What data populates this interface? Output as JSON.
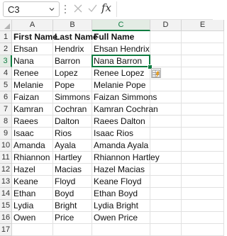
{
  "formula_bar": {
    "name_box": "C3",
    "fx_label": "fx",
    "formula_value": ""
  },
  "columns": [
    {
      "label": "A",
      "active": false
    },
    {
      "label": "B",
      "active": false
    },
    {
      "label": "C",
      "active": true
    },
    {
      "label": "D",
      "active": false
    },
    {
      "label": "E",
      "active": false
    }
  ],
  "rows": [
    {
      "num": "1",
      "cells": [
        "First Name",
        "Last Name",
        "Full Name",
        "",
        ""
      ]
    },
    {
      "num": "2",
      "cells": [
        "Ehsan",
        "Hendrix",
        "Ehsan Hendrix",
        "",
        ""
      ]
    },
    {
      "num": "3",
      "cells": [
        "Nana",
        "Barron",
        "Nana Barron",
        "",
        ""
      ]
    },
    {
      "num": "4",
      "cells": [
        "Renee",
        "Lopez",
        "Renee Lopez",
        "",
        ""
      ]
    },
    {
      "num": "5",
      "cells": [
        "Melanie",
        "Pope",
        "Melanie Pope",
        "",
        ""
      ]
    },
    {
      "num": "6",
      "cells": [
        "Faizan",
        "Simmons",
        "Faizan Simmons",
        "",
        ""
      ]
    },
    {
      "num": "7",
      "cells": [
        "Kamran",
        "Cochran",
        "Kamran Cochran",
        "",
        ""
      ]
    },
    {
      "num": "8",
      "cells": [
        "Raees",
        "Dalton",
        "Raees Dalton",
        "",
        ""
      ]
    },
    {
      "num": "9",
      "cells": [
        "Isaac",
        "Rios",
        "Isaac Rios",
        "",
        ""
      ]
    },
    {
      "num": "10",
      "cells": [
        "Amanda",
        "Ayala",
        "Amanda Ayala",
        "",
        ""
      ]
    },
    {
      "num": "11",
      "cells": [
        "Rhiannon",
        "Hartley",
        "Rhiannon Hartley",
        "",
        ""
      ]
    },
    {
      "num": "12",
      "cells": [
        "Hazel",
        "Macias",
        "Hazel Macias",
        "",
        ""
      ]
    },
    {
      "num": "13",
      "cells": [
        "Keane",
        "Floyd",
        "Keane Floyd",
        "",
        ""
      ]
    },
    {
      "num": "14",
      "cells": [
        "Ethan",
        "Boyd",
        "Ethan Boyd",
        "",
        ""
      ]
    },
    {
      "num": "15",
      "cells": [
        "Lydia",
        "Bright",
        "Lydia Bright",
        "",
        ""
      ]
    },
    {
      "num": "16",
      "cells": [
        "Owen",
        "Price",
        "Owen Price",
        "",
        ""
      ]
    },
    {
      "num": "17",
      "cells": [
        "",
        "",
        "",
        "",
        ""
      ]
    }
  ],
  "selection": {
    "row": 3,
    "col": "C"
  },
  "colors": {
    "accent": "#107c41",
    "header_bg": "#f2f2f2",
    "gridline": "#e1e1e1"
  },
  "icons": {
    "flash_fill": "flash-fill-options-icon",
    "dropdown": "chevron-down-icon"
  }
}
